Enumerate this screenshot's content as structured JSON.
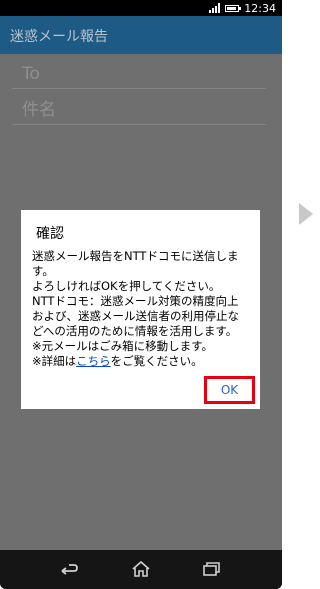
{
  "status": {
    "time": "12:34"
  },
  "app": {
    "title": "迷惑メール報告"
  },
  "form": {
    "to_label": "To",
    "subject_label": "件名"
  },
  "dialog": {
    "title": "確認",
    "lines": [
      "迷惑メール報告をNTTドコモに送信しま",
      "す。",
      "よろしければOKを押してください。",
      "NTTドコモ：迷惑メール対策の精度向上",
      "および、迷惑メール送信者の利用停止な",
      "どへの活用のために情報を活用します。",
      "※元メールはごみ箱に移動します。"
    ],
    "detail_prefix": "※詳細は",
    "detail_link": "こちら",
    "detail_suffix": "をご覧ください。",
    "ok_label": "OK"
  },
  "nav": {
    "back": "back-icon",
    "home": "home-icon",
    "recent": "recent-apps-icon"
  },
  "colors": {
    "appbar": "#1d5a85",
    "highlight": "#e60012",
    "link": "#0b47c6"
  }
}
